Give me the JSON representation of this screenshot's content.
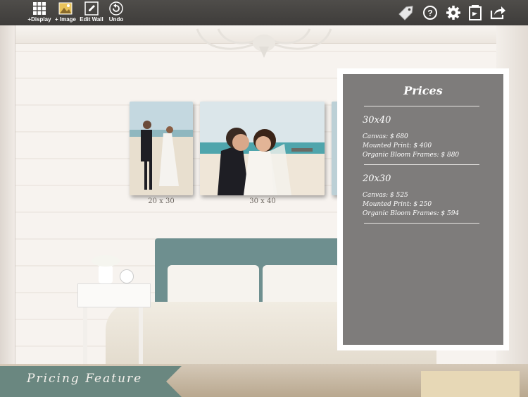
{
  "toolbar": {
    "display_label": "+Display",
    "image_label": "+ Image",
    "edit_wall_label": "Edit Wall",
    "undo_label": "Undo",
    "right_icons": [
      "price-tag-icon",
      "help-icon",
      "gear-icon",
      "gallery-icon",
      "share-icon"
    ]
  },
  "photos": [
    {
      "label": "20 x 30"
    },
    {
      "label": "30 x 40"
    }
  ],
  "prices": {
    "title": "Prices",
    "sizes": [
      {
        "heading": "30x40",
        "lines": [
          "Canvas: $ 680",
          "Mounted Print: $ 400",
          "Organic Bloom Frames: $ 880"
        ]
      },
      {
        "heading": "20x30",
        "lines": [
          "Canvas: $ 525",
          "Mounted Print: $ 250",
          "Organic Bloom Frames: $ 594"
        ]
      }
    ]
  },
  "banner": {
    "text": "Pricing Feature"
  },
  "colors": {
    "toolbar": "#4a4845",
    "panel": "#7e7c7b",
    "banner": "#6a8780"
  }
}
